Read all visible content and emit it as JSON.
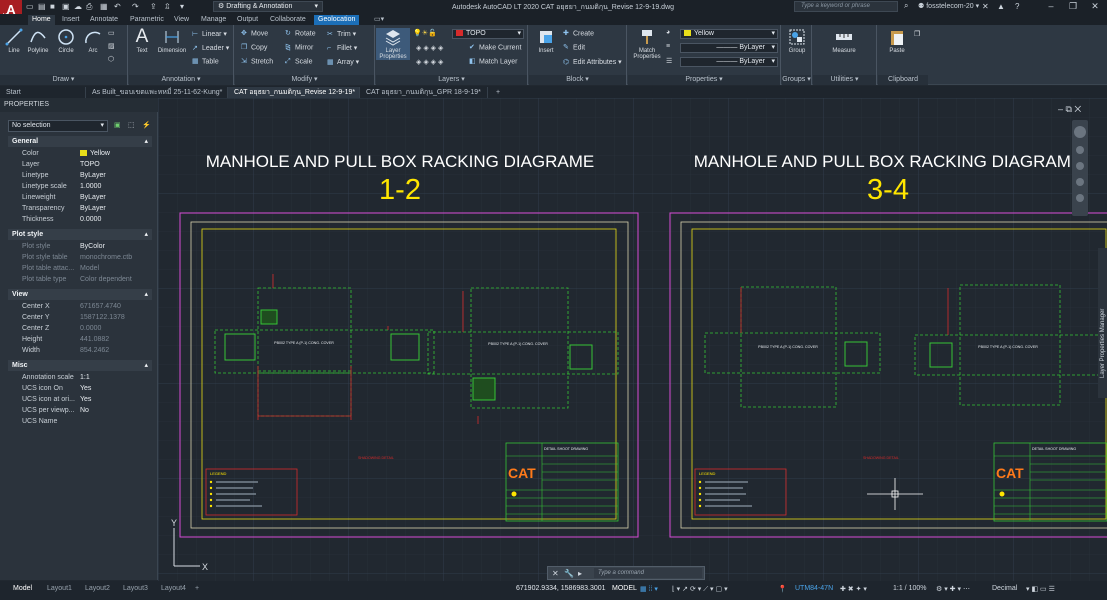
{
  "app": {
    "logo": "A",
    "logo_sub": "LT",
    "title": "Autodesk AutoCAD LT 2020    CAT อยุธยา_กนมติกุน_Revise 12-9-19.dwg",
    "workspace": "Drafting & Annotation",
    "search_placeholder": "Type a keyword or phrase",
    "user": "fosstelecom-20",
    "colors": {
      "accent": "#1c6fb8",
      "logo": "#a81e22",
      "bg": "#212830",
      "layer_swatch": "#e8de1a",
      "layer_topo": "#d62b2b"
    }
  },
  "ribbon_tabs": [
    "Home",
    "Insert",
    "Annotate",
    "Parametric",
    "View",
    "Manage",
    "Output",
    "Collaborate",
    "Geolocation"
  ],
  "ribbon": {
    "draw": {
      "title": "Draw",
      "tools": [
        "Line",
        "Polyline",
        "Circle",
        "Arc"
      ]
    },
    "annotation": {
      "title": "Annotation",
      "tools": [
        "Text",
        "Dimension"
      ],
      "small": [
        "Linear",
        "Leader",
        "Table"
      ]
    },
    "modify": {
      "title": "Modify",
      "small": [
        "Move",
        "Rotate",
        "Trim",
        "Copy",
        "Mirror",
        "Fillet",
        "Stretch",
        "Scale",
        "Array"
      ]
    },
    "layers": {
      "title": "Layers",
      "big": "Layer Properties",
      "current_layer": "TOPO",
      "small": [
        "Make Current",
        "Match Layer"
      ]
    },
    "block": {
      "title": "Block",
      "big": "Insert",
      "small": [
        "Create",
        "Edit",
        "Edit Attributes"
      ]
    },
    "properties": {
      "title": "Properties",
      "big": "Match Properties",
      "color": "Yellow",
      "linetype": "ByLayer",
      "lineweight": "ByLayer"
    },
    "groups": {
      "title": "Groups",
      "big": "Group"
    },
    "utilities": {
      "title": "Utilities",
      "big": "Measure"
    },
    "clipboard": {
      "title": "Clipboard",
      "big": "Paste"
    }
  },
  "doc_tabs": [
    "Start",
    "As Built_ขอบเขตแพะหหมื่ 25-11-62-Kung*",
    "CAT อยุธยา_กนมติกุน_Revise 12-9-19*",
    "CAT อยุธยา_กนมติกุน_GPR 18-9-19*"
  ],
  "properties_panel": {
    "title": "PROPERTIES",
    "selection": "No selection",
    "sections": [
      {
        "name": "General",
        "rows": [
          {
            "k": "Color",
            "v": "Yellow"
          },
          {
            "k": "Layer",
            "v": "TOPO"
          },
          {
            "k": "Linetype",
            "v": "ByLayer"
          },
          {
            "k": "Linetype scale",
            "v": "1.0000"
          },
          {
            "k": "Lineweight",
            "v": "ByLayer"
          },
          {
            "k": "Transparency",
            "v": "ByLayer"
          },
          {
            "k": "Thickness",
            "v": "0.0000"
          }
        ]
      },
      {
        "name": "Plot style",
        "rows": [
          {
            "k": "Plot style",
            "v": "ByColor"
          },
          {
            "k": "Plot style table",
            "v": "monochrome.ctb"
          },
          {
            "k": "Plot table attac...",
            "v": "Model"
          },
          {
            "k": "Plot table type",
            "v": "Color dependent"
          }
        ]
      },
      {
        "name": "View",
        "rows": [
          {
            "k": "Center X",
            "v": "671657.4740"
          },
          {
            "k": "Center Y",
            "v": "1587122.1378"
          },
          {
            "k": "Center Z",
            "v": "0.0000"
          },
          {
            "k": "Height",
            "v": "441.0882"
          },
          {
            "k": "Width",
            "v": "854.2462"
          }
        ]
      },
      {
        "name": "Misc",
        "rows": [
          {
            "k": "Annotation scale",
            "v": "1:1"
          },
          {
            "k": "UCS icon On",
            "v": "Yes"
          },
          {
            "k": "UCS icon at ori...",
            "v": "Yes"
          },
          {
            "k": "UCS per viewp...",
            "v": "No"
          },
          {
            "k": "UCS Name",
            "v": ""
          }
        ]
      }
    ]
  },
  "drawing": {
    "sheet1": {
      "title": "MANHOLE AND PULL BOX RACKING DIAGRAME",
      "number": "1-2"
    },
    "sheet2": {
      "title": "MANHOLE AND PULL BOX RACKING DIAGRAME",
      "number": "3-4"
    },
    "pit_label": "PB002 TYPE A (P-1) CONG. COVER",
    "detail_label": "SHADOWING DETAIL",
    "legend_title": "LEGEND",
    "brand": "CAT",
    "titleblock_head": "DETAIL SHOOT DRAWING",
    "side_palette": "Layer Properties Manager"
  },
  "layout_tabs": [
    "Model",
    "Layout1",
    "Layout2",
    "Layout3",
    "Layout4"
  ],
  "status": {
    "coords": "671902.9334, 1586983.3001",
    "space": "MODEL",
    "coord_sys": "UTM84-47N",
    "scale": "1:1 / 100%",
    "units": "Decimal",
    "cmd_placeholder": "Type a command"
  }
}
